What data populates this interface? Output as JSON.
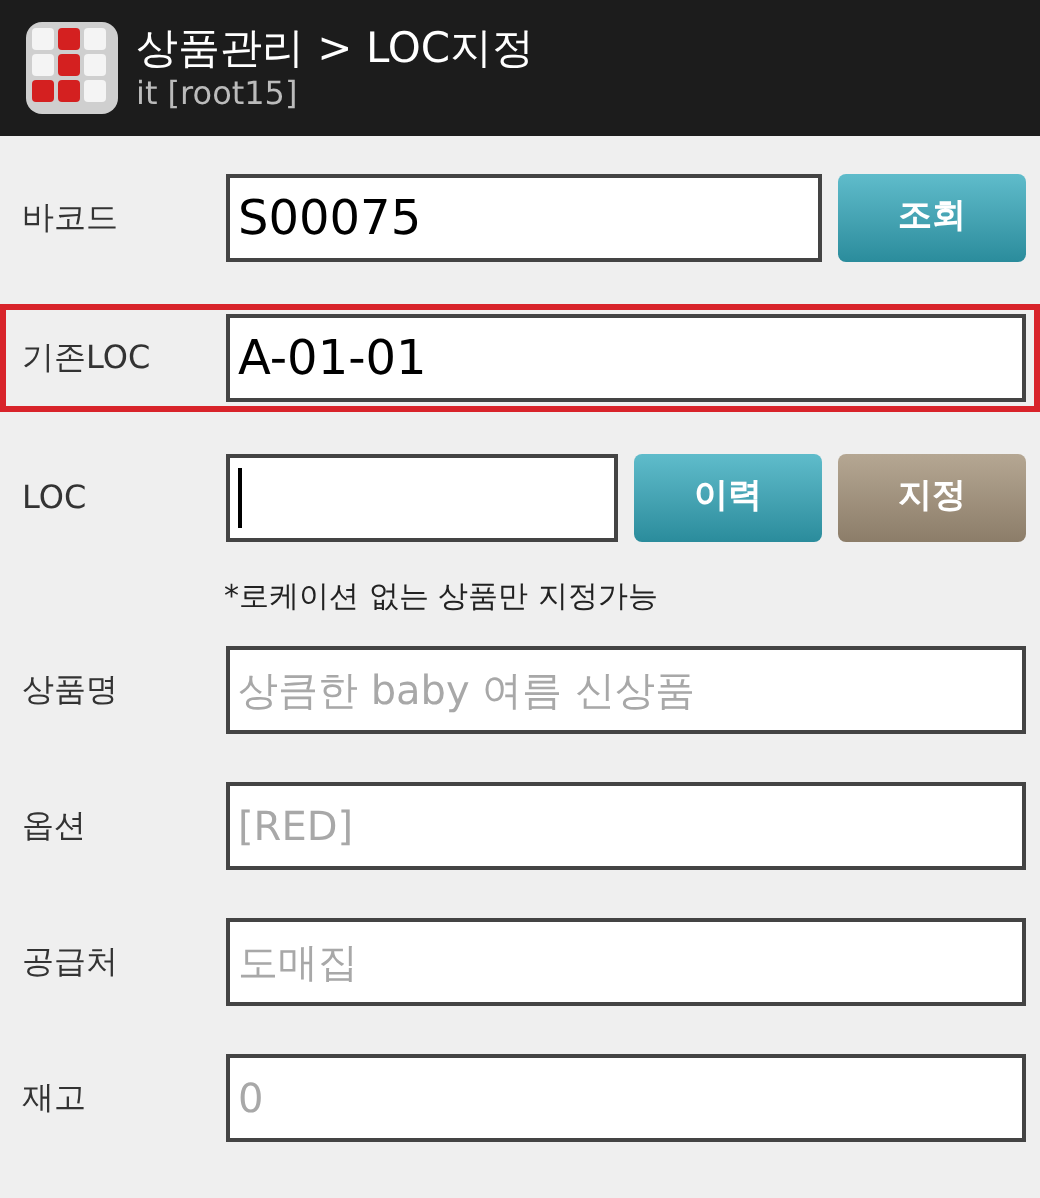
{
  "header": {
    "title": "상품관리 > LOC지정",
    "subtitle": "it [root15]"
  },
  "rows": [
    {
      "label": "바코드",
      "value": "S00075",
      "disabled": false,
      "highlighted": false,
      "focused": false,
      "buttons": [
        {
          "label": "조회",
          "kind": "primary"
        }
      ]
    },
    {
      "label": "기존LOC",
      "value": "A-01-01",
      "disabled": false,
      "highlighted": true,
      "focused": false
    },
    {
      "label": "LOC",
      "value": "",
      "disabled": false,
      "highlighted": false,
      "focused": true,
      "buttons": [
        {
          "label": "이력",
          "kind": "primary"
        },
        {
          "label": "지정",
          "kind": "secondary"
        }
      ]
    }
  ],
  "note": "*로케이션 없는 상품만 지정가능",
  "details": [
    {
      "label": "상품명",
      "value": "상큼한 baby 여름 신상품",
      "disabled": true
    },
    {
      "label": "옵션",
      "value": "[RED]",
      "disabled": true
    },
    {
      "label": "공급처",
      "value": "도매집",
      "disabled": true
    },
    {
      "label": "재고",
      "value": "0",
      "disabled": true
    }
  ]
}
